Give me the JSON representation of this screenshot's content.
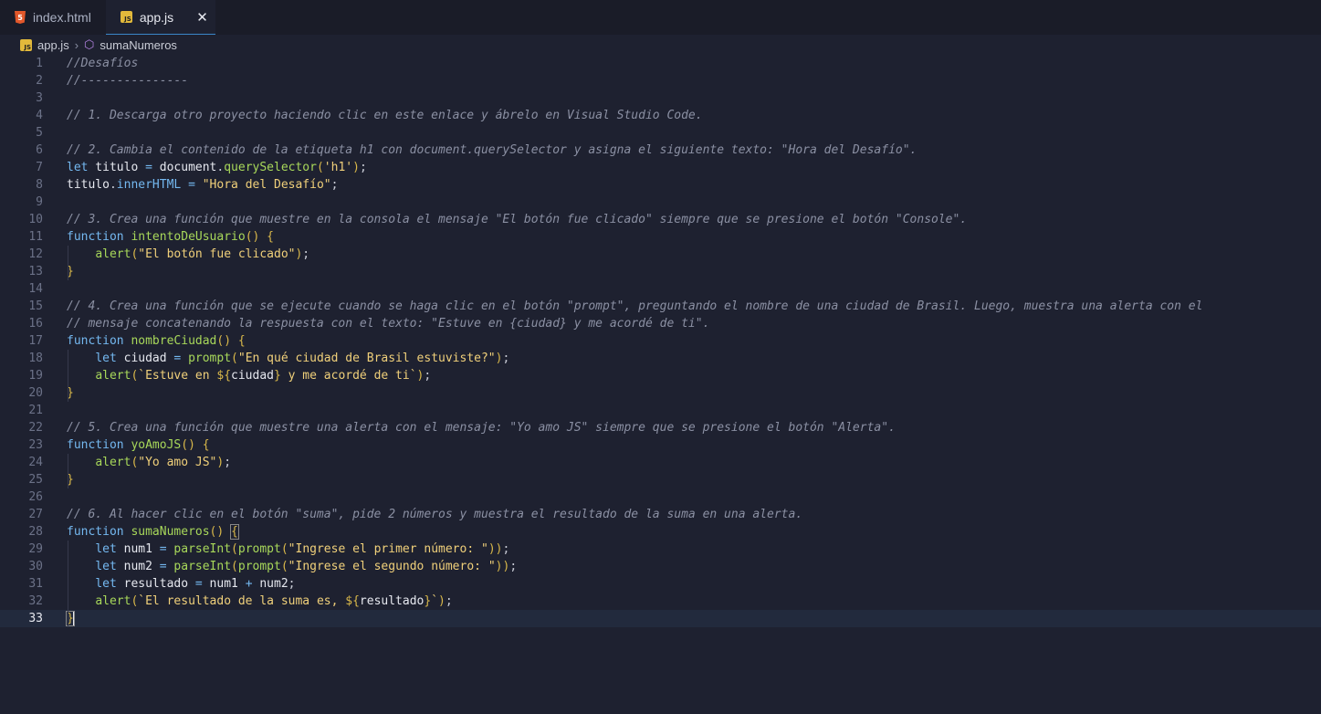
{
  "tabs": [
    {
      "label": "index.html",
      "icon": "html5-icon",
      "active": false
    },
    {
      "label": "app.js",
      "icon": "js-file-icon",
      "active": true
    }
  ],
  "breadcrumb": {
    "file": "app.js",
    "symbol": "sumaNumeros"
  },
  "current_line": 33,
  "lines": [
    [
      [
        "c",
        "//Desafíos"
      ]
    ],
    [
      [
        "c",
        "//---------------"
      ]
    ],
    [],
    [
      [
        "c",
        "// 1. Descarga otro proyecto haciendo clic en este enlace y ábrelo en Visual Studio Code."
      ]
    ],
    [],
    [
      [
        "c",
        "// 2. Cambia el contenido de la etiqueta h1 con document.querySelector y asigna el siguiente texto: \"Hora del Desafío\"."
      ]
    ],
    [
      [
        "k",
        "let"
      ],
      [
        "v",
        " titulo "
      ],
      [
        "o",
        "="
      ],
      [
        "v",
        " document"
      ],
      [
        "pu",
        "."
      ],
      [
        "f",
        "querySelector"
      ],
      [
        "p",
        "("
      ],
      [
        "s",
        "'h1'"
      ],
      [
        "p",
        ")"
      ],
      [
        "pu",
        ";"
      ]
    ],
    [
      [
        "v",
        "titulo"
      ],
      [
        "pu",
        "."
      ],
      [
        "m",
        "innerHTML"
      ],
      [
        "v",
        " "
      ],
      [
        "o",
        "="
      ],
      [
        "v",
        " "
      ],
      [
        "s",
        "\"Hora del Desafío\""
      ],
      [
        "pu",
        ";"
      ]
    ],
    [],
    [
      [
        "c",
        "// 3. Crea una función que muestre en la consola el mensaje \"El botón fue clicado\" siempre que se presione el botón \"Console\"."
      ]
    ],
    [
      [
        "k",
        "function"
      ],
      [
        "v",
        " "
      ],
      [
        "f",
        "intentoDeUsuario"
      ],
      [
        "p",
        "()"
      ],
      [
        "v",
        " "
      ],
      [
        "p",
        "{"
      ]
    ],
    [
      [
        "v",
        "    "
      ],
      [
        "f",
        "alert"
      ],
      [
        "p",
        "("
      ],
      [
        "s",
        "\"El botón fue clicado\""
      ],
      [
        "p",
        ")"
      ],
      [
        "pu",
        ";"
      ]
    ],
    [
      [
        "p",
        "}"
      ]
    ],
    [],
    [
      [
        "c",
        "// 4. Crea una función que se ejecute cuando se haga clic en el botón \"prompt\", preguntando el nombre de una ciudad de Brasil. Luego, muestra una alerta con el"
      ]
    ],
    [
      [
        "c",
        "// mensaje concatenando la respuesta con el texto: \"Estuve en {ciudad} y me acordé de ti\"."
      ]
    ],
    [
      [
        "k",
        "function"
      ],
      [
        "v",
        " "
      ],
      [
        "f",
        "nombreCiudad"
      ],
      [
        "p",
        "()"
      ],
      [
        "v",
        " "
      ],
      [
        "p",
        "{"
      ]
    ],
    [
      [
        "v",
        "    "
      ],
      [
        "k",
        "let"
      ],
      [
        "v",
        " ciudad "
      ],
      [
        "o",
        "="
      ],
      [
        "v",
        " "
      ],
      [
        "f",
        "prompt"
      ],
      [
        "p",
        "("
      ],
      [
        "s",
        "\"En qué ciudad de Brasil estuviste?\""
      ],
      [
        "p",
        ")"
      ],
      [
        "pu",
        ";"
      ]
    ],
    [
      [
        "v",
        "    "
      ],
      [
        "f",
        "alert"
      ],
      [
        "p",
        "("
      ],
      [
        "s",
        "`Estuve en "
      ],
      [
        "p",
        "${"
      ],
      [
        "v",
        "ciudad"
      ],
      [
        "p",
        "}"
      ],
      [
        "s",
        " y me acordé de ti`"
      ],
      [
        "p",
        ")"
      ],
      [
        "pu",
        ";"
      ]
    ],
    [
      [
        "p",
        "}"
      ]
    ],
    [],
    [
      [
        "c",
        "// 5. Crea una función que muestre una alerta con el mensaje: \"Yo amo JS\" siempre que se presione el botón \"Alerta\"."
      ]
    ],
    [
      [
        "k",
        "function"
      ],
      [
        "v",
        " "
      ],
      [
        "f",
        "yoAmoJS"
      ],
      [
        "p",
        "()"
      ],
      [
        "v",
        " "
      ],
      [
        "p",
        "{"
      ]
    ],
    [
      [
        "v",
        "    "
      ],
      [
        "f",
        "alert"
      ],
      [
        "p",
        "("
      ],
      [
        "s",
        "\"Yo amo JS\""
      ],
      [
        "p",
        ")"
      ],
      [
        "pu",
        ";"
      ]
    ],
    [
      [
        "p",
        "}"
      ]
    ],
    [],
    [
      [
        "c",
        "// 6. Al hacer clic en el botón \"suma\", pide 2 números y muestra el resultado de la suma en una alerta."
      ]
    ],
    [
      [
        "k",
        "function"
      ],
      [
        "v",
        " "
      ],
      [
        "f",
        "sumaNumeros"
      ],
      [
        "p",
        "()"
      ],
      [
        "v",
        " "
      ],
      [
        "p hl",
        "{"
      ]
    ],
    [
      [
        "v",
        "    "
      ],
      [
        "k",
        "let"
      ],
      [
        "v",
        " num1 "
      ],
      [
        "o",
        "="
      ],
      [
        "v",
        " "
      ],
      [
        "f",
        "parseInt"
      ],
      [
        "p",
        "("
      ],
      [
        "f",
        "prompt"
      ],
      [
        "p",
        "("
      ],
      [
        "s",
        "\"Ingrese el primer número: \""
      ],
      [
        "p",
        "))"
      ],
      [
        "pu",
        ";"
      ]
    ],
    [
      [
        "v",
        "    "
      ],
      [
        "k",
        "let"
      ],
      [
        "v",
        " num2 "
      ],
      [
        "o",
        "="
      ],
      [
        "v",
        " "
      ],
      [
        "f",
        "parseInt"
      ],
      [
        "p",
        "("
      ],
      [
        "f",
        "prompt"
      ],
      [
        "p",
        "("
      ],
      [
        "s",
        "\"Ingrese el segundo número: \""
      ],
      [
        "p",
        "))"
      ],
      [
        "pu",
        ";"
      ]
    ],
    [
      [
        "v",
        "    "
      ],
      [
        "k",
        "let"
      ],
      [
        "v",
        " resultado "
      ],
      [
        "o",
        "="
      ],
      [
        "v",
        " num1 "
      ],
      [
        "o",
        "+"
      ],
      [
        "v",
        " num2"
      ],
      [
        "pu",
        ";"
      ]
    ],
    [
      [
        "v",
        "    "
      ],
      [
        "f",
        "alert"
      ],
      [
        "p",
        "("
      ],
      [
        "s",
        "`El resultado de la suma es, "
      ],
      [
        "p",
        "${"
      ],
      [
        "v",
        "resultado"
      ],
      [
        "p",
        "}"
      ],
      [
        "s",
        "`"
      ],
      [
        "p",
        ")"
      ],
      [
        "pu",
        ";"
      ]
    ],
    [
      [
        "p hl",
        "}"
      ]
    ]
  ]
}
